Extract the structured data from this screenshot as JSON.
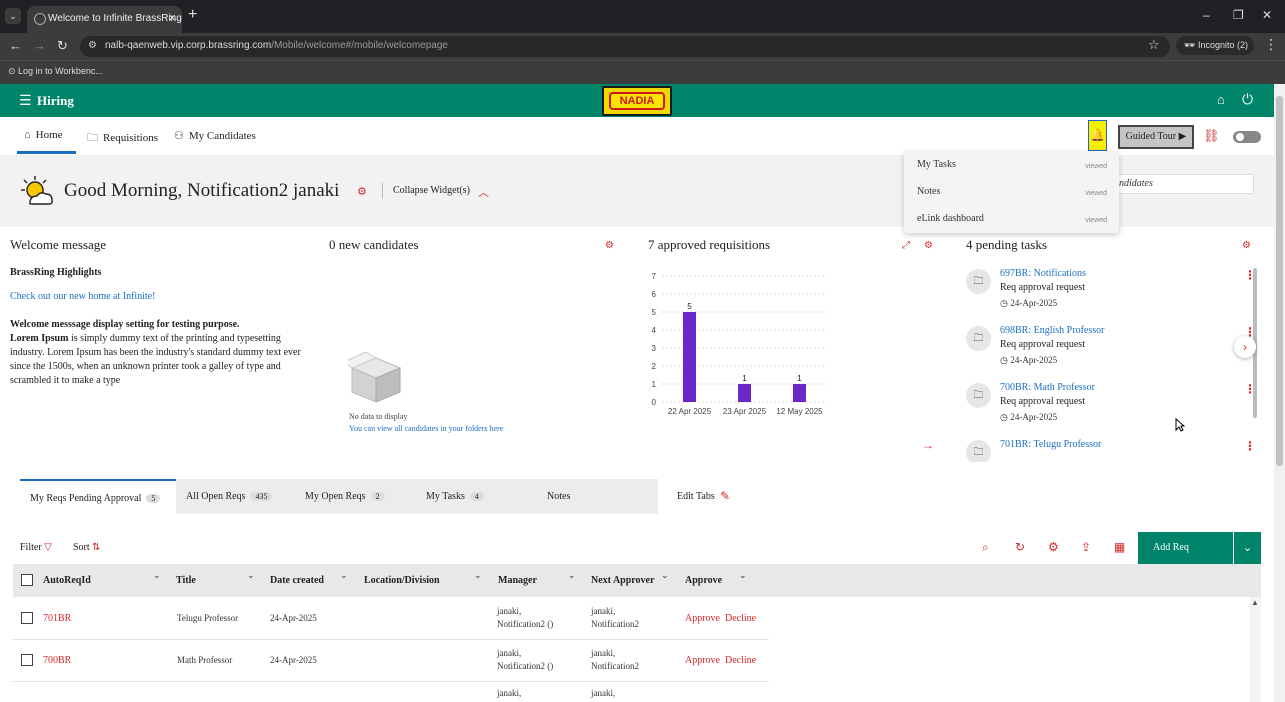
{
  "browser": {
    "tab_title": "Welcome to Infinite BrassRing",
    "url_host": "nalb-qaenweb.vip.corp.brassring.com",
    "url_path": "/Mobile/welcome#/mobile/welcomepage",
    "incognito": "Incognito (2)",
    "bookmark": "Log in to Workbenc..."
  },
  "header": {
    "app_title": "Hiring",
    "logo_text": "NADIA"
  },
  "nav": {
    "tabs": [
      {
        "label": "Home",
        "icon": "home-outline-icon"
      },
      {
        "label": "Requisitions",
        "icon": "folder-icon"
      },
      {
        "label": "My Candidates",
        "icon": "people-icon"
      }
    ],
    "guided_tour": "Guided Tour ▶"
  },
  "greeting": {
    "text": "Good Morning, Notification2 janaki",
    "collapse": "Collapse Widget(s)"
  },
  "search": {
    "value": "ndidates"
  },
  "dropdown": {
    "items": [
      {
        "label": "My Tasks",
        "badge": "viewed"
      },
      {
        "label": "Notes",
        "badge": "viewed"
      },
      {
        "label": "eLink dashboard",
        "badge": "viewed"
      }
    ]
  },
  "widgets": {
    "welcome": {
      "title": "Welcome message",
      "highlights": "BrassRing Highlights",
      "link": "Check out our new home at Infinite!",
      "bold_line": "Welcome messsage display setting for testing purpose.",
      "lorem_bold": "Lorem Ipsum",
      "lorem_rest": " is simply dummy text of the printing and typesetting industry. Lorem Ipsum has been the industry's standard dummy text ever since the 1500s, when an unknown printer took a galley of type and scrambled it to make a type"
    },
    "candidates": {
      "title": "0 new candidates",
      "no_data": "No data to display",
      "link": "You can view all candidates in your folders here"
    },
    "approved": {
      "title": "7 approved requisitions"
    },
    "tasks": {
      "title": "4 pending tasks",
      "items": [
        {
          "link": "697BR: Notifications",
          "sub": "Req approval request",
          "date": "24-Apr-2025"
        },
        {
          "link": "698BR: English Professor",
          "sub": "Req approval request",
          "date": "24-Apr-2025"
        },
        {
          "link": "700BR: Math Professor",
          "sub": "Req approval request",
          "date": "24-Apr-2025"
        },
        {
          "link": "701BR: Telugu Professor",
          "sub": "",
          "date": ""
        }
      ]
    }
  },
  "chart_data": {
    "type": "bar",
    "categories": [
      "22 Apr 2025",
      "23 Apr 2025",
      "12 May 2025"
    ],
    "values": [
      5,
      1,
      1
    ],
    "yticks": [
      0,
      1,
      2,
      3,
      4,
      5,
      6,
      7
    ],
    "ylim": [
      0,
      7
    ],
    "grid": true,
    "color": "#6a28c8"
  },
  "section_tabs": [
    {
      "label": "My Reqs Pending Approval",
      "count": "5"
    },
    {
      "label": "All Open Reqs",
      "count": "435"
    },
    {
      "label": "My Open Reqs",
      "count": "2"
    },
    {
      "label": "My Tasks",
      "count": "4"
    },
    {
      "label": "Notes",
      "count": ""
    }
  ],
  "edit_tabs": "Edit Tabs",
  "toolbar": {
    "filter": "Filter",
    "sort": "Sort",
    "add_req": "Add Req"
  },
  "table": {
    "columns": [
      "AutoReqId",
      "Title",
      "Date created",
      "Location/Division",
      "Manager",
      "Next Approver",
      "Approve"
    ],
    "rows": [
      {
        "id": "701BR",
        "title": "Telugu Professor",
        "date": "24-Apr-2025",
        "location": "",
        "manager_1": "janaki,",
        "manager_2": "Notification2 ()",
        "approver_1": "janaki,",
        "approver_2": "Notification2",
        "approve": "Approve",
        "decline": "Decline"
      },
      {
        "id": "700BR",
        "title": "Math Professor",
        "date": "24-Apr-2025",
        "location": "",
        "manager_1": "janaki,",
        "manager_2": "Notification2 ()",
        "approver_1": "janaki,",
        "approver_2": "Notification2",
        "approve": "Approve",
        "decline": "Decline"
      },
      {
        "id": "",
        "title": "",
        "date": "",
        "location": "",
        "manager_1": "janaki,",
        "manager_2": "",
        "approver_1": "janaki,",
        "approver_2": "",
        "approve": "",
        "decline": ""
      }
    ]
  }
}
